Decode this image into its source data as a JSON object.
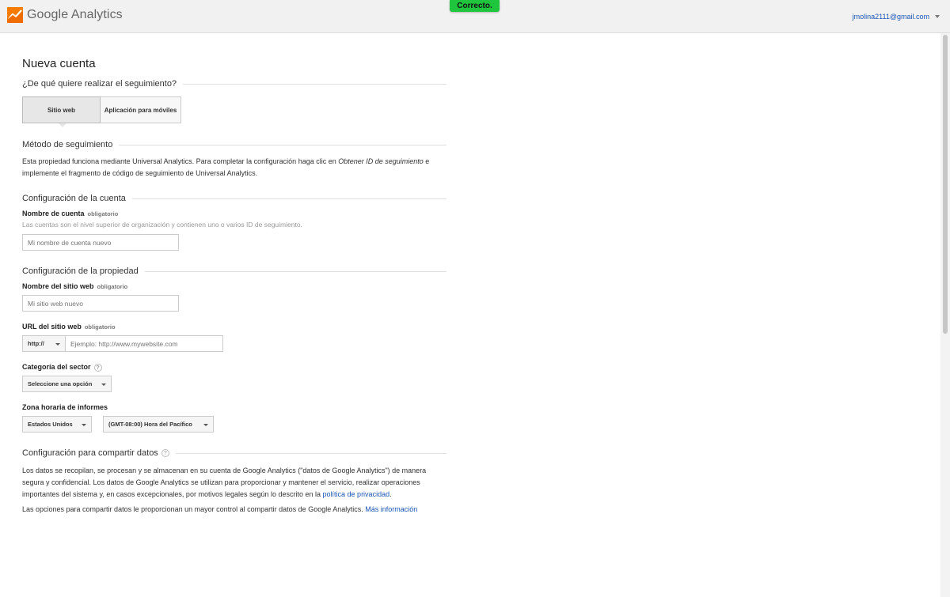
{
  "header": {
    "brand": "Google Analytics",
    "toast": "Correcto.",
    "user_email": "jmolina2111@gmail.com"
  },
  "page": {
    "title": "Nueva cuenta",
    "tracking_question": "¿De qué quiere realizar el seguimiento?",
    "tabs": [
      "Sitio web",
      "Aplicación para móviles"
    ],
    "selected_tab": "Sitio web"
  },
  "tracking_method": {
    "heading": "Método de seguimiento",
    "text_1": "Esta propiedad funciona mediante Universal Analytics. Para completar la configuración haga clic en ",
    "text_em": "Obtener ID de seguimiento",
    "text_2": " e implemente el fragmento de código de seguimiento de Universal Analytics."
  },
  "account": {
    "heading": "Configuración de la cuenta",
    "name_label": "Nombre de cuenta",
    "required": "obligatorio",
    "name_hint": "Las cuentas son el nivel superior de organización y contienen uno o varios ID de seguimiento.",
    "name_placeholder": "Mi nombre de cuenta nuevo"
  },
  "property": {
    "heading": "Configuración de la propiedad",
    "site_name_label": "Nombre del sitio web",
    "site_name_placeholder": "Mi sitio web nuevo",
    "url_label": "URL del sitio web",
    "protocol": "http://",
    "url_placeholder": "Ejemplo: http://www.mywebsite.com",
    "category_label": "Categoría del sector",
    "help_glyph": "?",
    "category_value": "Seleccione una opción",
    "timezone_label": "Zona horaria de informes",
    "country_value": "Estados Unidos",
    "timezone_value": "(GMT-08:00) Hora del Pacífico"
  },
  "data_sharing": {
    "heading": "Configuración para compartir datos",
    "para1_text": "Los datos se recopilan, se procesan y se almacenan en su cuenta de Google Analytics (\"datos de Google Analytics\") de manera segura y confidencial. Los datos de Google Analytics se utilizan para proporcionar y mantener el servicio, realizar operaciones importantes del sistema y, en casos excepcionales, por motivos legales según lo descrito en la ",
    "privacy_link": "política de privacidad",
    "para1_end": ".",
    "para2_text": "Las opciones para compartir datos le proporcionan un mayor control al compartir datos de Google Analytics. ",
    "more_info_link": "Más información"
  },
  "colors": {
    "toast_bg": "#1fc63d",
    "link": "#1a55b5",
    "logo_orange": "#f57c00"
  }
}
